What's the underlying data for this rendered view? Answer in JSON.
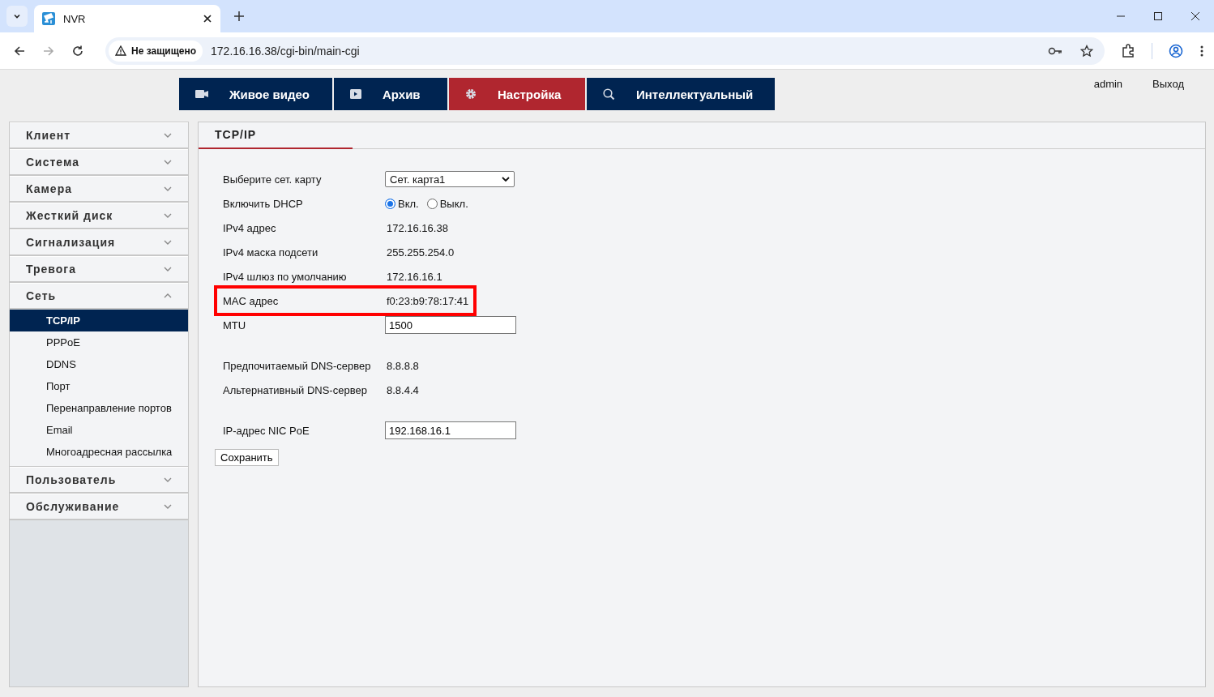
{
  "browser": {
    "tab_title": "NVR",
    "security_label": "Не защищено",
    "url": "172.16.16.38/cgi-bin/main-cgi"
  },
  "nav": [
    {
      "label": "Живое видео",
      "kind": "live",
      "selected": false
    },
    {
      "label": "Архив",
      "kind": "archive",
      "selected": false
    },
    {
      "label": "Настройка",
      "kind": "settings",
      "selected": true
    },
    {
      "label": "Интеллектуальный",
      "kind": "smart",
      "selected": false
    }
  ],
  "user": "admin",
  "logout": "Выход",
  "sidebar": [
    {
      "label": "Клиент",
      "expanded": false
    },
    {
      "label": "Система",
      "expanded": false
    },
    {
      "label": "Камера",
      "expanded": false
    },
    {
      "label": "Жесткий диск",
      "expanded": false
    },
    {
      "label": "Сигнализация",
      "expanded": false
    },
    {
      "label": "Тревога",
      "expanded": false
    },
    {
      "label": "Сеть",
      "expanded": true,
      "children": [
        {
          "label": "TCP/IP",
          "selected": true
        },
        {
          "label": "PPPoE",
          "selected": false
        },
        {
          "label": "DDNS",
          "selected": false
        },
        {
          "label": "Порт",
          "selected": false
        },
        {
          "label": "Перенаправление портов",
          "selected": false
        },
        {
          "label": "Email",
          "selected": false
        },
        {
          "label": "Многоадресная рассылка",
          "selected": false
        }
      ]
    },
    {
      "label": "Пользователь",
      "expanded": false
    },
    {
      "label": "Обслуживание",
      "expanded": false
    }
  ],
  "panel": {
    "title": "TCP/IP",
    "rows": [
      {
        "kind": "select",
        "label": "Выберите сет. карту",
        "value": "Сет. карта1"
      },
      {
        "kind": "radio",
        "label": "Включить DHCP",
        "options": [
          {
            "label": "Вкл.",
            "selected": true
          },
          {
            "label": "Выкл.",
            "selected": false
          }
        ]
      },
      {
        "kind": "text",
        "label": "IPv4 адрес",
        "value": "172.16.16.38"
      },
      {
        "kind": "text",
        "label": "IPv4 маска подсети",
        "value": "255.255.254.0"
      },
      {
        "kind": "text",
        "label": "IPv4 шлюз по умолчанию",
        "value": "172.16.16.1"
      },
      {
        "kind": "text",
        "label": "MAC адрес",
        "value": "f0:23:b9:78:17:41",
        "highlighted": true
      },
      {
        "kind": "input",
        "label": "MTU",
        "value": "1500"
      },
      {
        "kind": "text",
        "label": "Предпочитаемый DNS-сервер",
        "value": "8.8.8.8",
        "gap_before": true
      },
      {
        "kind": "text",
        "label": "Альтернативный DNS-сервер",
        "value": "8.8.4.4"
      },
      {
        "kind": "input",
        "label": "IP-адрес NIC PoE",
        "value": "192.168.16.1",
        "gap_before": true
      }
    ],
    "save_button": "Сохранить"
  }
}
